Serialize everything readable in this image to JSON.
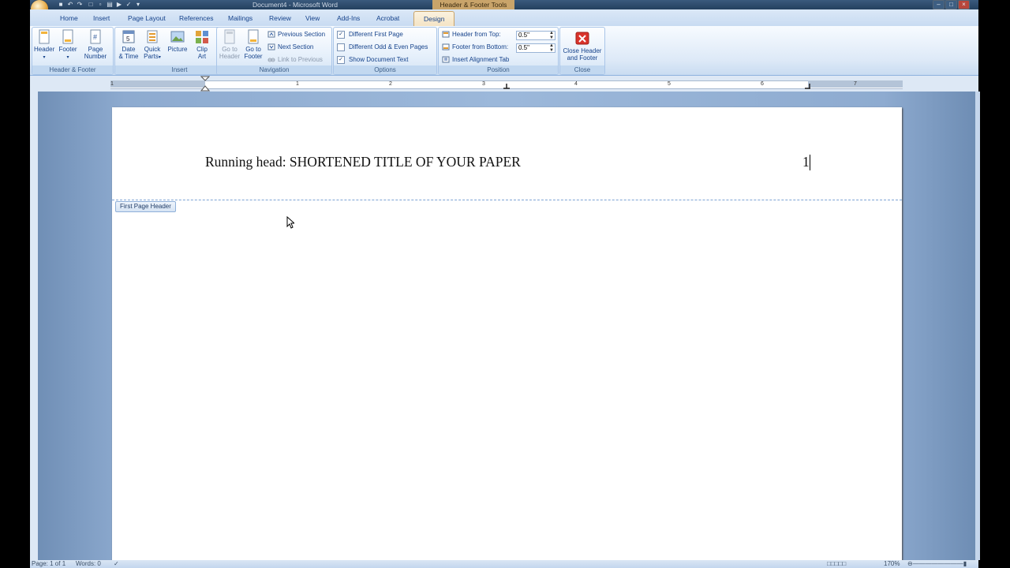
{
  "window": {
    "title": "Document4 - Microsoft Word",
    "context_tab_group": "Header & Footer Tools"
  },
  "tabs": [
    "Home",
    "Insert",
    "Page Layout",
    "References",
    "Mailings",
    "Review",
    "View",
    "Add-Ins",
    "Acrobat",
    "Design"
  ],
  "active_tab": "Design",
  "ribbon": {
    "header_footer": {
      "title": "Header & Footer",
      "header": "Header",
      "footer": "Footer",
      "page_number_1": "Page",
      "page_number_2": "Number"
    },
    "insert": {
      "title": "Insert",
      "date_time_1": "Date",
      "date_time_2": "& Time",
      "quick_parts_1": "Quick",
      "quick_parts_2": "Parts",
      "picture": "Picture",
      "clip_art_1": "Clip",
      "clip_art_2": "Art"
    },
    "navigation": {
      "title": "Navigation",
      "go_to_header_1": "Go to",
      "go_to_header_2": "Header",
      "go_to_footer_1": "Go to",
      "go_to_footer_2": "Footer",
      "previous_section": "Previous Section",
      "next_section": "Next Section",
      "link_to_previous": "Link to Previous"
    },
    "options": {
      "title": "Options",
      "different_first_page": "Different First Page",
      "different_odd_even": "Different Odd & Even Pages",
      "show_document_text": "Show Document Text",
      "different_first_page_checked": true,
      "different_odd_even_checked": false,
      "show_document_text_checked": true
    },
    "position": {
      "title": "Position",
      "header_from_top_label": "Header from Top:",
      "header_from_top_value": "0.5\"",
      "footer_from_bottom_label": "Footer from Bottom:",
      "footer_from_bottom_value": "0.5\"",
      "insert_alignment_tab": "Insert Alignment Tab"
    },
    "close": {
      "title": "Close",
      "close_header_footer_1": "Close Header",
      "close_header_footer_2": "and Footer"
    }
  },
  "ruler": {
    "numbers": [
      "1",
      "1",
      "2",
      "3",
      "4",
      "5",
      "6",
      "7"
    ]
  },
  "document": {
    "header_text": "Running head: SHORTENED TITLE OF YOUR PAPER",
    "page_number": "1",
    "header_label": "First Page Header"
  },
  "status": {
    "page": "Page: 1 of 1",
    "words": "Words: 0",
    "zoom": "170%"
  },
  "colors": {
    "ribbon_text": "#15428b",
    "context_tab": "#c9a46a",
    "close_icon": "#d9332b"
  }
}
